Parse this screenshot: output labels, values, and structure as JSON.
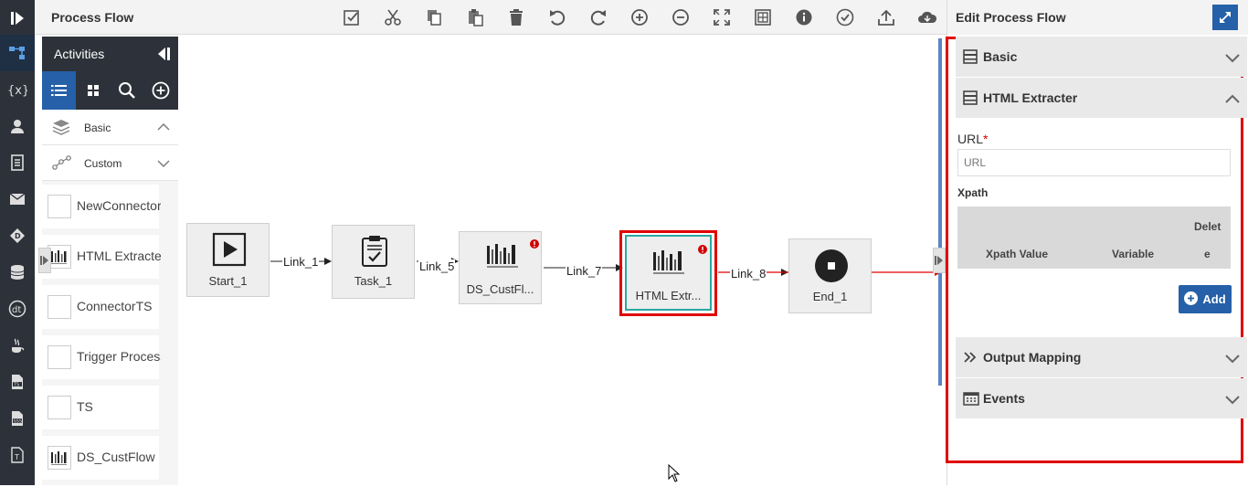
{
  "header": {
    "title": "Process Flow"
  },
  "toolbar": {
    "buttons": [
      "validate-icon",
      "cut-icon",
      "copy-icon",
      "paste-icon",
      "delete-icon",
      "undo-icon",
      "redo-icon",
      "zoom-in-icon",
      "zoom-out-icon",
      "fit-screen-icon",
      "grid-icon",
      "info-icon",
      "check-icon",
      "upload-icon",
      "cloud-icon"
    ]
  },
  "activities": {
    "title": "Activities",
    "categories": [
      {
        "label": "Basic"
      },
      {
        "label": "Custom"
      }
    ],
    "items": [
      {
        "label": "NewConnector"
      },
      {
        "label": "HTML Extracter"
      },
      {
        "label": "ConnectorTS"
      },
      {
        "label": "Trigger Process"
      },
      {
        "label": "TS"
      },
      {
        "label": "DS_CustFlow"
      }
    ]
  },
  "canvas": {
    "nodes": {
      "start": "Start_1",
      "task": "Task_1",
      "ds": "DS_CustFl...",
      "html": "HTML Extr...",
      "end": "End_1"
    },
    "links": {
      "l1": "Link_1",
      "l5": "Link_5",
      "l7": "Link_7",
      "l8": "Link_8"
    }
  },
  "panel": {
    "title": "Edit Process Flow",
    "sections": {
      "basic": "Basic",
      "html": "HTML Extracter",
      "output": "Output Mapping",
      "events": "Events"
    },
    "url_label": "URL",
    "required_mark": "*",
    "url_placeholder": "URL",
    "xpath_label": "Xpath",
    "table": {
      "col1": "Xpath Value",
      "col2": "Variable",
      "col3a": "Delet",
      "col3b": "e"
    },
    "add_label": "Add"
  },
  "colors": {
    "accent": "#2560a8",
    "highlight": "#e00000",
    "rail": "#2d323a"
  }
}
